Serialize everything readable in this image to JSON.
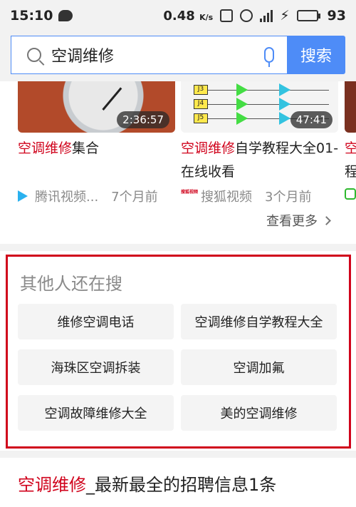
{
  "status_bar": {
    "time": "15:10",
    "net_speed": "0.48",
    "net_unit": "K/s",
    "battery": "93",
    "battery_level": 0.93
  },
  "search": {
    "query": "空调维修",
    "button_label": "搜索"
  },
  "videos": [
    {
      "title_highlight": "空调维修",
      "title_rest": "集合",
      "duration": "2:36:57",
      "source": "腾讯视频...",
      "age": "7个月前"
    },
    {
      "title_highlight": "空调维修",
      "title_rest": "自学教程大全01-在线收看",
      "duration": "47:41",
      "source": "搜狐视频",
      "age": "3个月前",
      "source_icon_text": "搜狐视频"
    },
    {
      "title_highlight": "空",
      "title_rest": "程"
    }
  ],
  "circuit_labels": [
    "J3",
    "J4",
    "J5"
  ],
  "more_label": "查看更多",
  "related": {
    "title": "其他人还在搜",
    "items": [
      "维修空调电话",
      "空调维修自学教程大全",
      "海珠区空调拆装",
      "空调加氟",
      "空调故障维修大全",
      "美的空调维修"
    ]
  },
  "result": {
    "title_highlight": "空调维修",
    "title_rest": "_最新最全的招聘信息1条"
  },
  "colors": {
    "accent": "#4e8cf7",
    "highlight": "#d0021b"
  }
}
